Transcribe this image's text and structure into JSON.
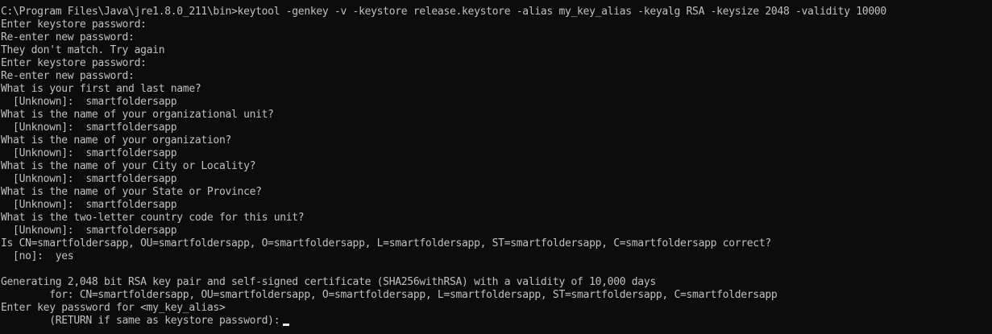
{
  "terminal": {
    "lines": [
      "C:\\Program Files\\Java\\jre1.8.0_211\\bin>keytool -genkey -v -keystore release.keystore -alias my_key_alias -keyalg RSA -keysize 2048 -validity 10000",
      "Enter keystore password:",
      "Re-enter new password:",
      "They don't match. Try again",
      "Enter keystore password:",
      "Re-enter new password:",
      "What is your first and last name?",
      "  [Unknown]:  smartfoldersapp",
      "What is the name of your organizational unit?",
      "  [Unknown]:  smartfoldersapp",
      "What is the name of your organization?",
      "  [Unknown]:  smartfoldersapp",
      "What is the name of your City or Locality?",
      "  [Unknown]:  smartfoldersapp",
      "What is the name of your State or Province?",
      "  [Unknown]:  smartfoldersapp",
      "What is the two-letter country code for this unit?",
      "  [Unknown]:  smartfoldersapp",
      "Is CN=smartfoldersapp, OU=smartfoldersapp, O=smartfoldersapp, L=smartfoldersapp, ST=smartfoldersapp, C=smartfoldersapp correct?",
      "  [no]:  yes",
      "",
      "Generating 2,048 bit RSA key pair and self-signed certificate (SHA256withRSA) with a validity of 10,000 days",
      "        for: CN=smartfoldersapp, OU=smartfoldersapp, O=smartfoldersapp, L=smartfoldersapp, ST=smartfoldersapp, C=smartfoldersapp",
      "Enter key password for <my_key_alias>",
      "        (RETURN if same as keystore password):"
    ]
  },
  "colors": {
    "background": "#0c0c0c",
    "text": "#c0c0c0"
  }
}
